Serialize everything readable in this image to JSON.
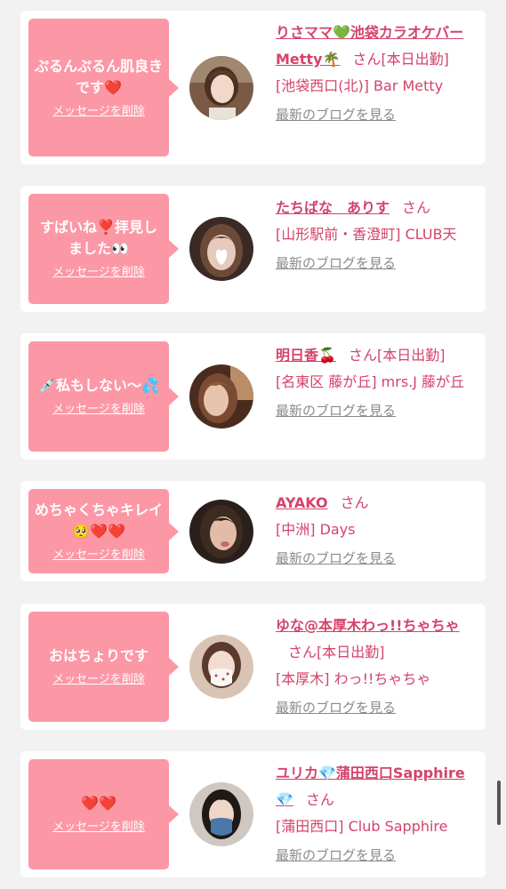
{
  "colors": {
    "accent": "#d4436b",
    "bubble": "#fc97a6",
    "card_bg": "#ffffff",
    "page_bg": "#f2f2f2",
    "muted": "#8a8a8a"
  },
  "cards": [
    {
      "message": "ぷるんぷるん肌良きです❤️",
      "delete_label": "メッセージを削除",
      "name": "りさママ💚池袋カラオケバーMetty🌴",
      "suffix": "さん",
      "status": "[本日出勤]",
      "location": "[池袋西口(北)] Bar Metty",
      "blog_link": "最新のブログを見る",
      "avatar_icon": "woman-portrait-icon"
    },
    {
      "message": "すばいね❣️拝見しました👀",
      "delete_label": "メッセージを削除",
      "name": "たちばな　ありす",
      "suffix": "さん",
      "status": "",
      "location": "[山形駅前・香澄町] CLUB天",
      "blog_link": "最新のブログを見る",
      "avatar_icon": "woman-portrait-icon"
    },
    {
      "message": "💉私もしない〜💦",
      "delete_label": "メッセージを削除",
      "name": "明日香🍒",
      "suffix": "さん",
      "status": "[本日出勤]",
      "location": "[名東区 藤が丘] mrs.J 藤が丘",
      "blog_link": "最新のブログを見る",
      "avatar_icon": "woman-portrait-icon"
    },
    {
      "message": "めちゃくちゃキレイ🥺❤️❤️",
      "delete_label": "メッセージを削除",
      "name": "AYAKO",
      "suffix": "さん",
      "status": "",
      "location": "[中洲] Days",
      "blog_link": "最新のブログを見る",
      "avatar_icon": "woman-portrait-icon"
    },
    {
      "message": "おはちょりです",
      "delete_label": "メッセージを削除",
      "name": "ゆな@本厚木わっ!!ちゃちゃ",
      "suffix": "さん",
      "status": "[本日出勤]",
      "location": "[本厚木] わっ!!ちゃちゃ",
      "blog_link": "最新のブログを見る",
      "avatar_icon": "woman-portrait-icon"
    },
    {
      "message": "❤️❤️",
      "delete_label": "メッセージを削除",
      "name": "ユリカ💎蒲田西口Sapphire💎",
      "suffix": "さん",
      "status": "",
      "location": "[蒲田西口] Club Sapphire",
      "blog_link": "最新のブログを見る",
      "avatar_icon": "woman-portrait-icon"
    }
  ]
}
